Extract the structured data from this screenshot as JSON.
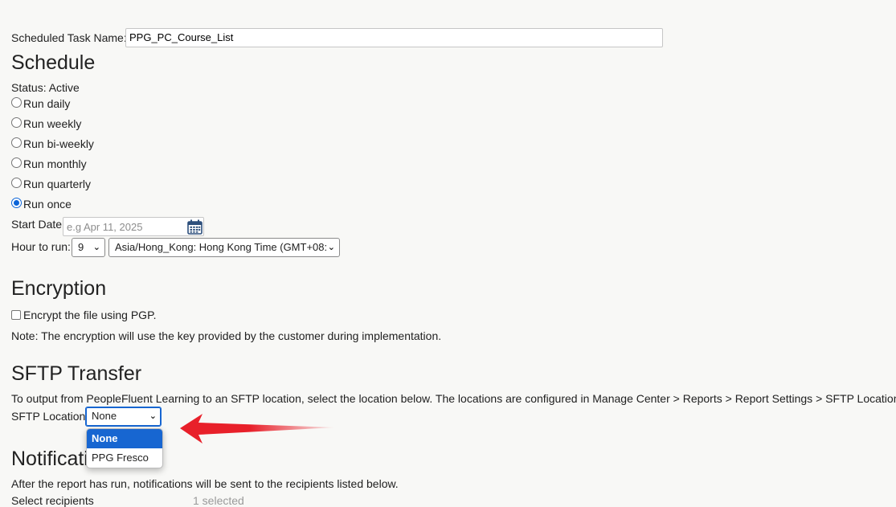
{
  "task": {
    "label": "Scheduled Task Name:",
    "value": "PPG_PC_Course_List"
  },
  "schedule": {
    "heading": "Schedule",
    "status": "Status: Active",
    "options": [
      "Run daily",
      "Run weekly",
      "Run bi-weekly",
      "Run monthly",
      "Run quarterly",
      "Run once"
    ],
    "selected_option": "Run once",
    "start_date_label": "Start Date:",
    "start_date_placeholder": "e.g Apr 11, 2025",
    "hour_label": "Hour to run:",
    "hour_value": "9",
    "timezone_value": "Asia/Hong_Kong: Hong Kong Time (GMT+08:"
  },
  "encryption": {
    "heading": "Encryption",
    "checkbox_label": "Encrypt the file using PGP.",
    "checked": false,
    "note": "Note: The encryption will use the key provided by the customer during implementation."
  },
  "sftp": {
    "heading": "SFTP Transfer",
    "description": "To output from PeopleFluent Learning to an SFTP location, select the location below. The locations are configured in Manage Center > Reports > Report Settings > SFTP Locations",
    "location_label": "SFTP Location:",
    "location_value": "None",
    "dropdown_options": [
      "None",
      "PPG Fresco"
    ]
  },
  "notifications": {
    "heading": "Notifications",
    "description": "After the report has run, notifications will be sent to the recipients listed below.",
    "select_label": "Select recipients",
    "selected_count": "1 selected"
  },
  "colors": {
    "accent": "#1766d1",
    "arrow": "#e8202a"
  },
  "icons": {
    "calendar": "calendar-icon",
    "chevron": "chevron-down-icon"
  }
}
